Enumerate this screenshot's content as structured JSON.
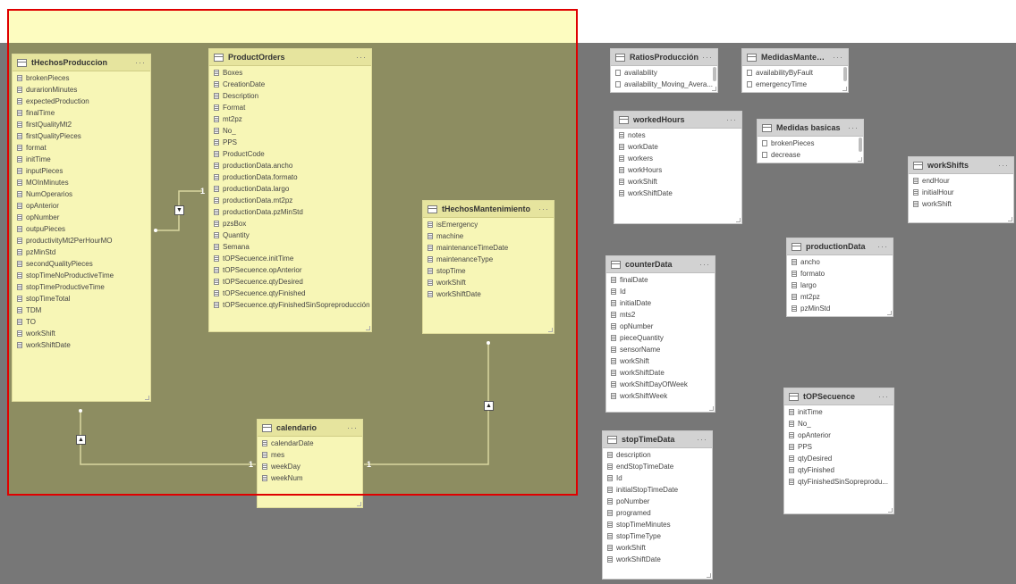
{
  "tables": [
    {
      "id": "tHechosProduccion",
      "name": "tHechosProduccion",
      "highlight": true,
      "fields": [
        "brokenPieces",
        "durarionMinutes",
        "expectedProduction",
        "finalTime",
        "firstQualityMt2",
        "firstQualityPieces",
        "format",
        "initTime",
        "inputPieces",
        "MOInMinutes",
        "NumOperarios",
        "opAnterior",
        "opNumber",
        "outpuPieces",
        "productivityMt2PerHourMO",
        "pzMinStd",
        "secondQualityPieces",
        "stopTimeNoProductiveTime",
        "stopTimeProductiveTime",
        "stopTimeTotal",
        "TDM",
        "TO",
        "workShift",
        "workShiftDate"
      ]
    },
    {
      "id": "ProductOrders",
      "name": "ProductOrders",
      "highlight": true,
      "fields": [
        "Boxes",
        "CreationDate",
        "Description",
        "Format",
        "mt2pz",
        "No_",
        "PPS",
        "ProductCode",
        "productionData.ancho",
        "productionData.formato",
        "productionData.largo",
        "productionData.mt2pz",
        "productionData.pzMinStd",
        "pzsBox",
        "Quantity",
        "Semana",
        "tOPSecuence.initTime",
        "tOPSecuence.opAnterior",
        "tOPSecuence.qtyDesired",
        "tOPSecuence.qtyFinished",
        "tOPSecuence.qtyFinishedSinSopreproducción"
      ]
    },
    {
      "id": "tHechosMantenimiento",
      "name": "tHechosMantenimiento",
      "highlight": true,
      "fields": [
        "isEmergency",
        "machine",
        "maintenanceTimeDate",
        "maintenanceType",
        "stopTime",
        "workShift",
        "workShiftDate"
      ]
    },
    {
      "id": "calendario",
      "name": "calendario",
      "highlight": true,
      "fields": [
        "calendarDate",
        "mes",
        "weekDay",
        "weekNum"
      ]
    },
    {
      "id": "RatiosProduccion",
      "name": "RatiosProducción",
      "highlight": false,
      "fields": [
        "availability",
        "availability_Moving_Avera..."
      ]
    },
    {
      "id": "MedidasMantenimiento",
      "name": "MedidasMantenimie...",
      "highlight": false,
      "fields": [
        "availabilityByFault",
        "emergencyTime"
      ]
    },
    {
      "id": "workedHours",
      "name": "workedHours",
      "highlight": false,
      "fields": [
        "notes",
        "workDate",
        "workers",
        "workHours",
        "workShift",
        "workShiftDate"
      ]
    },
    {
      "id": "MedidasBasicas",
      "name": "Medidas basicas",
      "highlight": false,
      "fields": [
        "brokenPieces",
        "decrease"
      ]
    },
    {
      "id": "workShifts",
      "name": "workShifts",
      "highlight": false,
      "fields": [
        "endHour",
        "initialHour",
        "workShift"
      ]
    },
    {
      "id": "productionData",
      "name": "productionData",
      "highlight": false,
      "fields": [
        "ancho",
        "formato",
        "largo",
        "mt2pz",
        "pzMinStd"
      ]
    },
    {
      "id": "counterData",
      "name": "counterData",
      "highlight": false,
      "fields": [
        "finalDate",
        "Id",
        "initialDate",
        "mts2",
        "opNumber",
        "pieceQuantity",
        "sensorName",
        "workShift",
        "workShiftDate",
        "workShiftDayOfWeek",
        "workShiftWeek"
      ]
    },
    {
      "id": "tOPSecuence",
      "name": "tOPSecuence",
      "highlight": false,
      "fields": [
        "initTime",
        "No_",
        "opAnterior",
        "PPS",
        "qtyDesired",
        "qtyFinished",
        "qtyFinishedSinSopreprodu..."
      ]
    },
    {
      "id": "stopTimeData",
      "name": "stopTimeData",
      "highlight": false,
      "fields": [
        "description",
        "endStopTimeDate",
        "Id",
        "initialStopTimeDate",
        "poNumber",
        "programed",
        "stopTimeMinutes",
        "stopTimeType",
        "workShift",
        "workShiftDate"
      ]
    }
  ],
  "more_label": "···",
  "relationships": [
    {
      "from": "tHechosProduccion",
      "to": "ProductOrders",
      "one_label": "1",
      "direction": "▼"
    },
    {
      "from": "tHechosProduccion",
      "to": "calendario",
      "one_label": "1",
      "direction": "▲"
    },
    {
      "from": "tHechosMantenimiento",
      "to": "calendario",
      "one_label": "1",
      "direction": "▲"
    }
  ],
  "colors": {
    "canvas": "#777777",
    "selection_border": "#e00000",
    "table_highlight": "#f7f6b6"
  }
}
